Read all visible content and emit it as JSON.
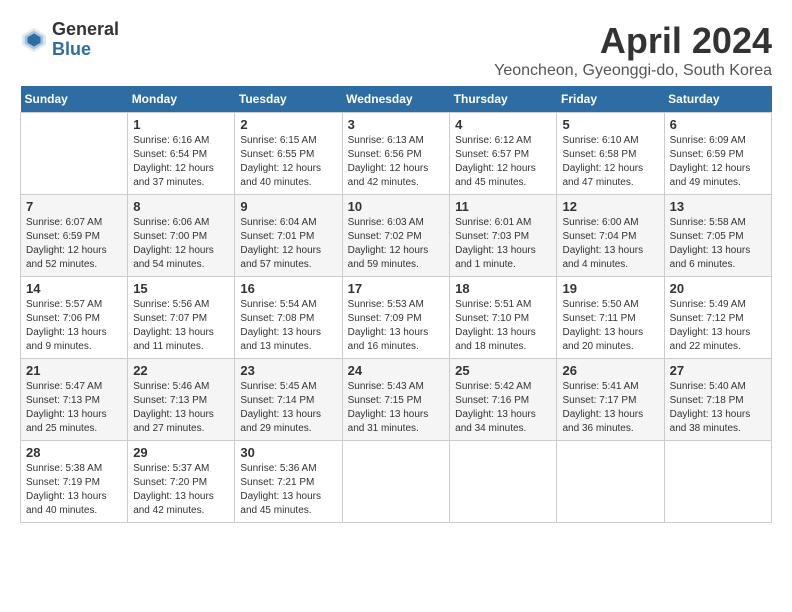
{
  "header": {
    "logo_general": "General",
    "logo_blue": "Blue",
    "month_title": "April 2024",
    "location": "Yeoncheon, Gyeonggi-do, South Korea"
  },
  "weekdays": [
    "Sunday",
    "Monday",
    "Tuesday",
    "Wednesday",
    "Thursday",
    "Friday",
    "Saturday"
  ],
  "weeks": [
    [
      {
        "day": "",
        "info": ""
      },
      {
        "day": "1",
        "info": "Sunrise: 6:16 AM\nSunset: 6:54 PM\nDaylight: 12 hours\nand 37 minutes."
      },
      {
        "day": "2",
        "info": "Sunrise: 6:15 AM\nSunset: 6:55 PM\nDaylight: 12 hours\nand 40 minutes."
      },
      {
        "day": "3",
        "info": "Sunrise: 6:13 AM\nSunset: 6:56 PM\nDaylight: 12 hours\nand 42 minutes."
      },
      {
        "day": "4",
        "info": "Sunrise: 6:12 AM\nSunset: 6:57 PM\nDaylight: 12 hours\nand 45 minutes."
      },
      {
        "day": "5",
        "info": "Sunrise: 6:10 AM\nSunset: 6:58 PM\nDaylight: 12 hours\nand 47 minutes."
      },
      {
        "day": "6",
        "info": "Sunrise: 6:09 AM\nSunset: 6:59 PM\nDaylight: 12 hours\nand 49 minutes."
      }
    ],
    [
      {
        "day": "7",
        "info": "Sunrise: 6:07 AM\nSunset: 6:59 PM\nDaylight: 12 hours\nand 52 minutes."
      },
      {
        "day": "8",
        "info": "Sunrise: 6:06 AM\nSunset: 7:00 PM\nDaylight: 12 hours\nand 54 minutes."
      },
      {
        "day": "9",
        "info": "Sunrise: 6:04 AM\nSunset: 7:01 PM\nDaylight: 12 hours\nand 57 minutes."
      },
      {
        "day": "10",
        "info": "Sunrise: 6:03 AM\nSunset: 7:02 PM\nDaylight: 12 hours\nand 59 minutes."
      },
      {
        "day": "11",
        "info": "Sunrise: 6:01 AM\nSunset: 7:03 PM\nDaylight: 13 hours\nand 1 minute."
      },
      {
        "day": "12",
        "info": "Sunrise: 6:00 AM\nSunset: 7:04 PM\nDaylight: 13 hours\nand 4 minutes."
      },
      {
        "day": "13",
        "info": "Sunrise: 5:58 AM\nSunset: 7:05 PM\nDaylight: 13 hours\nand 6 minutes."
      }
    ],
    [
      {
        "day": "14",
        "info": "Sunrise: 5:57 AM\nSunset: 7:06 PM\nDaylight: 13 hours\nand 9 minutes."
      },
      {
        "day": "15",
        "info": "Sunrise: 5:56 AM\nSunset: 7:07 PM\nDaylight: 13 hours\nand 11 minutes."
      },
      {
        "day": "16",
        "info": "Sunrise: 5:54 AM\nSunset: 7:08 PM\nDaylight: 13 hours\nand 13 minutes."
      },
      {
        "day": "17",
        "info": "Sunrise: 5:53 AM\nSunset: 7:09 PM\nDaylight: 13 hours\nand 16 minutes."
      },
      {
        "day": "18",
        "info": "Sunrise: 5:51 AM\nSunset: 7:10 PM\nDaylight: 13 hours\nand 18 minutes."
      },
      {
        "day": "19",
        "info": "Sunrise: 5:50 AM\nSunset: 7:11 PM\nDaylight: 13 hours\nand 20 minutes."
      },
      {
        "day": "20",
        "info": "Sunrise: 5:49 AM\nSunset: 7:12 PM\nDaylight: 13 hours\nand 22 minutes."
      }
    ],
    [
      {
        "day": "21",
        "info": "Sunrise: 5:47 AM\nSunset: 7:13 PM\nDaylight: 13 hours\nand 25 minutes."
      },
      {
        "day": "22",
        "info": "Sunrise: 5:46 AM\nSunset: 7:13 PM\nDaylight: 13 hours\nand 27 minutes."
      },
      {
        "day": "23",
        "info": "Sunrise: 5:45 AM\nSunset: 7:14 PM\nDaylight: 13 hours\nand 29 minutes."
      },
      {
        "day": "24",
        "info": "Sunrise: 5:43 AM\nSunset: 7:15 PM\nDaylight: 13 hours\nand 31 minutes."
      },
      {
        "day": "25",
        "info": "Sunrise: 5:42 AM\nSunset: 7:16 PM\nDaylight: 13 hours\nand 34 minutes."
      },
      {
        "day": "26",
        "info": "Sunrise: 5:41 AM\nSunset: 7:17 PM\nDaylight: 13 hours\nand 36 minutes."
      },
      {
        "day": "27",
        "info": "Sunrise: 5:40 AM\nSunset: 7:18 PM\nDaylight: 13 hours\nand 38 minutes."
      }
    ],
    [
      {
        "day": "28",
        "info": "Sunrise: 5:38 AM\nSunset: 7:19 PM\nDaylight: 13 hours\nand 40 minutes."
      },
      {
        "day": "29",
        "info": "Sunrise: 5:37 AM\nSunset: 7:20 PM\nDaylight: 13 hours\nand 42 minutes."
      },
      {
        "day": "30",
        "info": "Sunrise: 5:36 AM\nSunset: 7:21 PM\nDaylight: 13 hours\nand 45 minutes."
      },
      {
        "day": "",
        "info": ""
      },
      {
        "day": "",
        "info": ""
      },
      {
        "day": "",
        "info": ""
      },
      {
        "day": "",
        "info": ""
      }
    ]
  ]
}
